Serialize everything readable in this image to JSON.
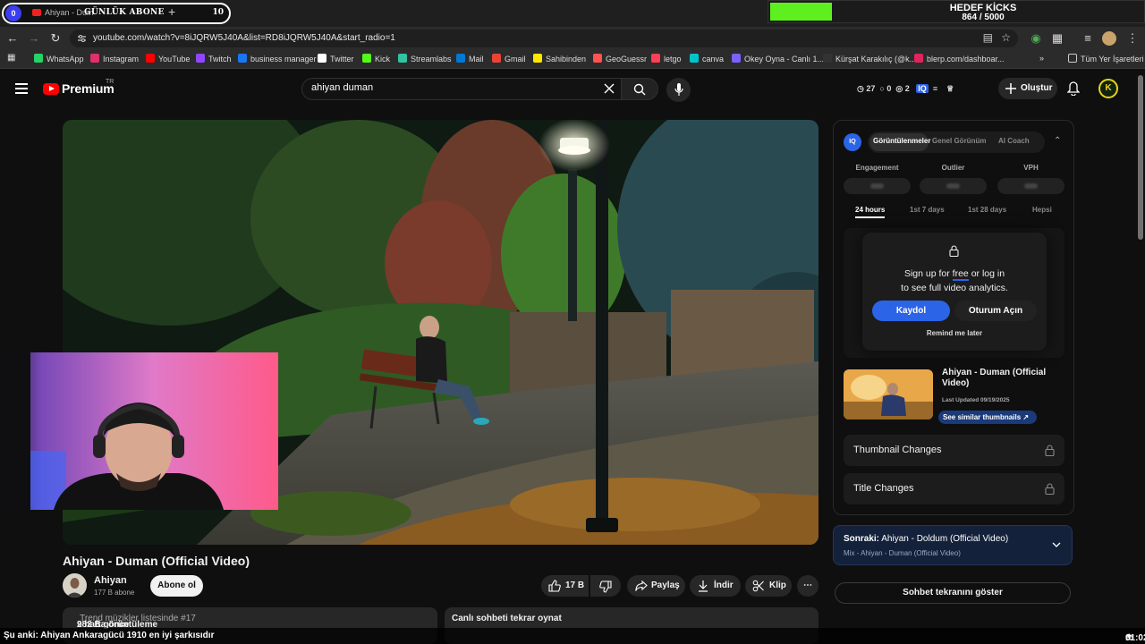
{
  "browser": {
    "tab_title": "Ahiyan - Dum",
    "widget": {
      "badge": "0",
      "title": "GÜNLÜK ABONE",
      "count": "10"
    },
    "url": "youtube.com/watch?v=8iJQRW5J40A&list=RD8iJQRW5J40A&start_radio=1",
    "bookmarks": [
      {
        "label": "WhatsApp",
        "color": "#25d366"
      },
      {
        "label": "Instagram",
        "color": "#e1306c"
      },
      {
        "label": "YouTube",
        "color": "#ff0000"
      },
      {
        "label": "Twitch",
        "color": "#9146ff"
      },
      {
        "label": "business manager",
        "color": "#1877f2"
      },
      {
        "label": "Twitter",
        "color": "#ffffff"
      },
      {
        "label": "Kick",
        "color": "#53fc18"
      },
      {
        "label": "Streamlabs",
        "color": "#31c3a2"
      },
      {
        "label": "Mail",
        "color": "#0078d4"
      },
      {
        "label": "Gmail",
        "color": "#ea4335"
      },
      {
        "label": "Sahibinden",
        "color": "#ffe800"
      },
      {
        "label": "GeoGuessr",
        "color": "#ff5252"
      },
      {
        "label": "letgo",
        "color": "#ff3f55"
      },
      {
        "label": "canva",
        "color": "#00c4cc"
      },
      {
        "label": "Okey Oyna - Canlı 1...",
        "color": "#7b61ff"
      },
      {
        "label": "Kürşat Karakılıç (@k...",
        "color": "#333333"
      },
      {
        "label": "blerp.com/dashboar...",
        "color": "#e0245e"
      }
    ],
    "all_bookmarks": "Tüm Yer İşaretleri"
  },
  "goal": {
    "title": "HEDEF KİCKS",
    "progress": "864 / 5000",
    "fraction": 0.1728
  },
  "youtube": {
    "logo": "Premium",
    "logo_region": "TR",
    "search_query": "ahiyan duman",
    "stats": {
      "a": "27",
      "b": "0",
      "c": "2"
    },
    "create_label": "Oluştur",
    "avatar_letter": "K"
  },
  "video": {
    "title": "Ahiyan - Duman (Official Video)",
    "channel": "Ahiyan",
    "subs": "177 B abone",
    "subscribe": "Abone ol",
    "likes": "17 B",
    "share": "Paylaş",
    "download": "İndir",
    "clip": "Klip",
    "views": "982 B görüntüleme",
    "age": "2 hafta önce",
    "trend": "Trend müzikler listesinde #17",
    "chat_replay": "Canlı sohbeti tekrar oynat"
  },
  "iq": {
    "logo": "IQ",
    "tabs": [
      "Görüntülenmeler",
      "Genel Görünüm",
      "AI Coach"
    ],
    "metrics": [
      "Engagement",
      "Outlier",
      "VPH"
    ],
    "ranges": [
      "24 hours",
      "1st 7 days",
      "1st 28 days",
      "Hepsi"
    ],
    "lock_msg_1": "Sign up for",
    "lock_msg_free": "free",
    "lock_msg_2": "or log in",
    "lock_msg_3": "to see full video analytics.",
    "signup": "Kaydol",
    "login": "Oturum Açın",
    "remind": "Remind me later",
    "mini_title": "Ahiyan - Duman (Official Video)",
    "mini_updated": "Last Updated 09/19/2025",
    "similar": "See similar thumbnails ↗",
    "thumb_changes": "Thumbnail Changes",
    "title_changes": "Title Changes"
  },
  "next": {
    "prefix": "Sonraki:",
    "title": "Ahiyan - Doldum (Official Video)",
    "sub": "Mix - Ahiyan - Duman (Official Video)"
  },
  "chat_btn": "Sohbet tekranını göster",
  "ticker": "Şu anki: Ahiyan Ankaragücü 1910 en iyi şarkısıdır",
  "clock": "01:02"
}
